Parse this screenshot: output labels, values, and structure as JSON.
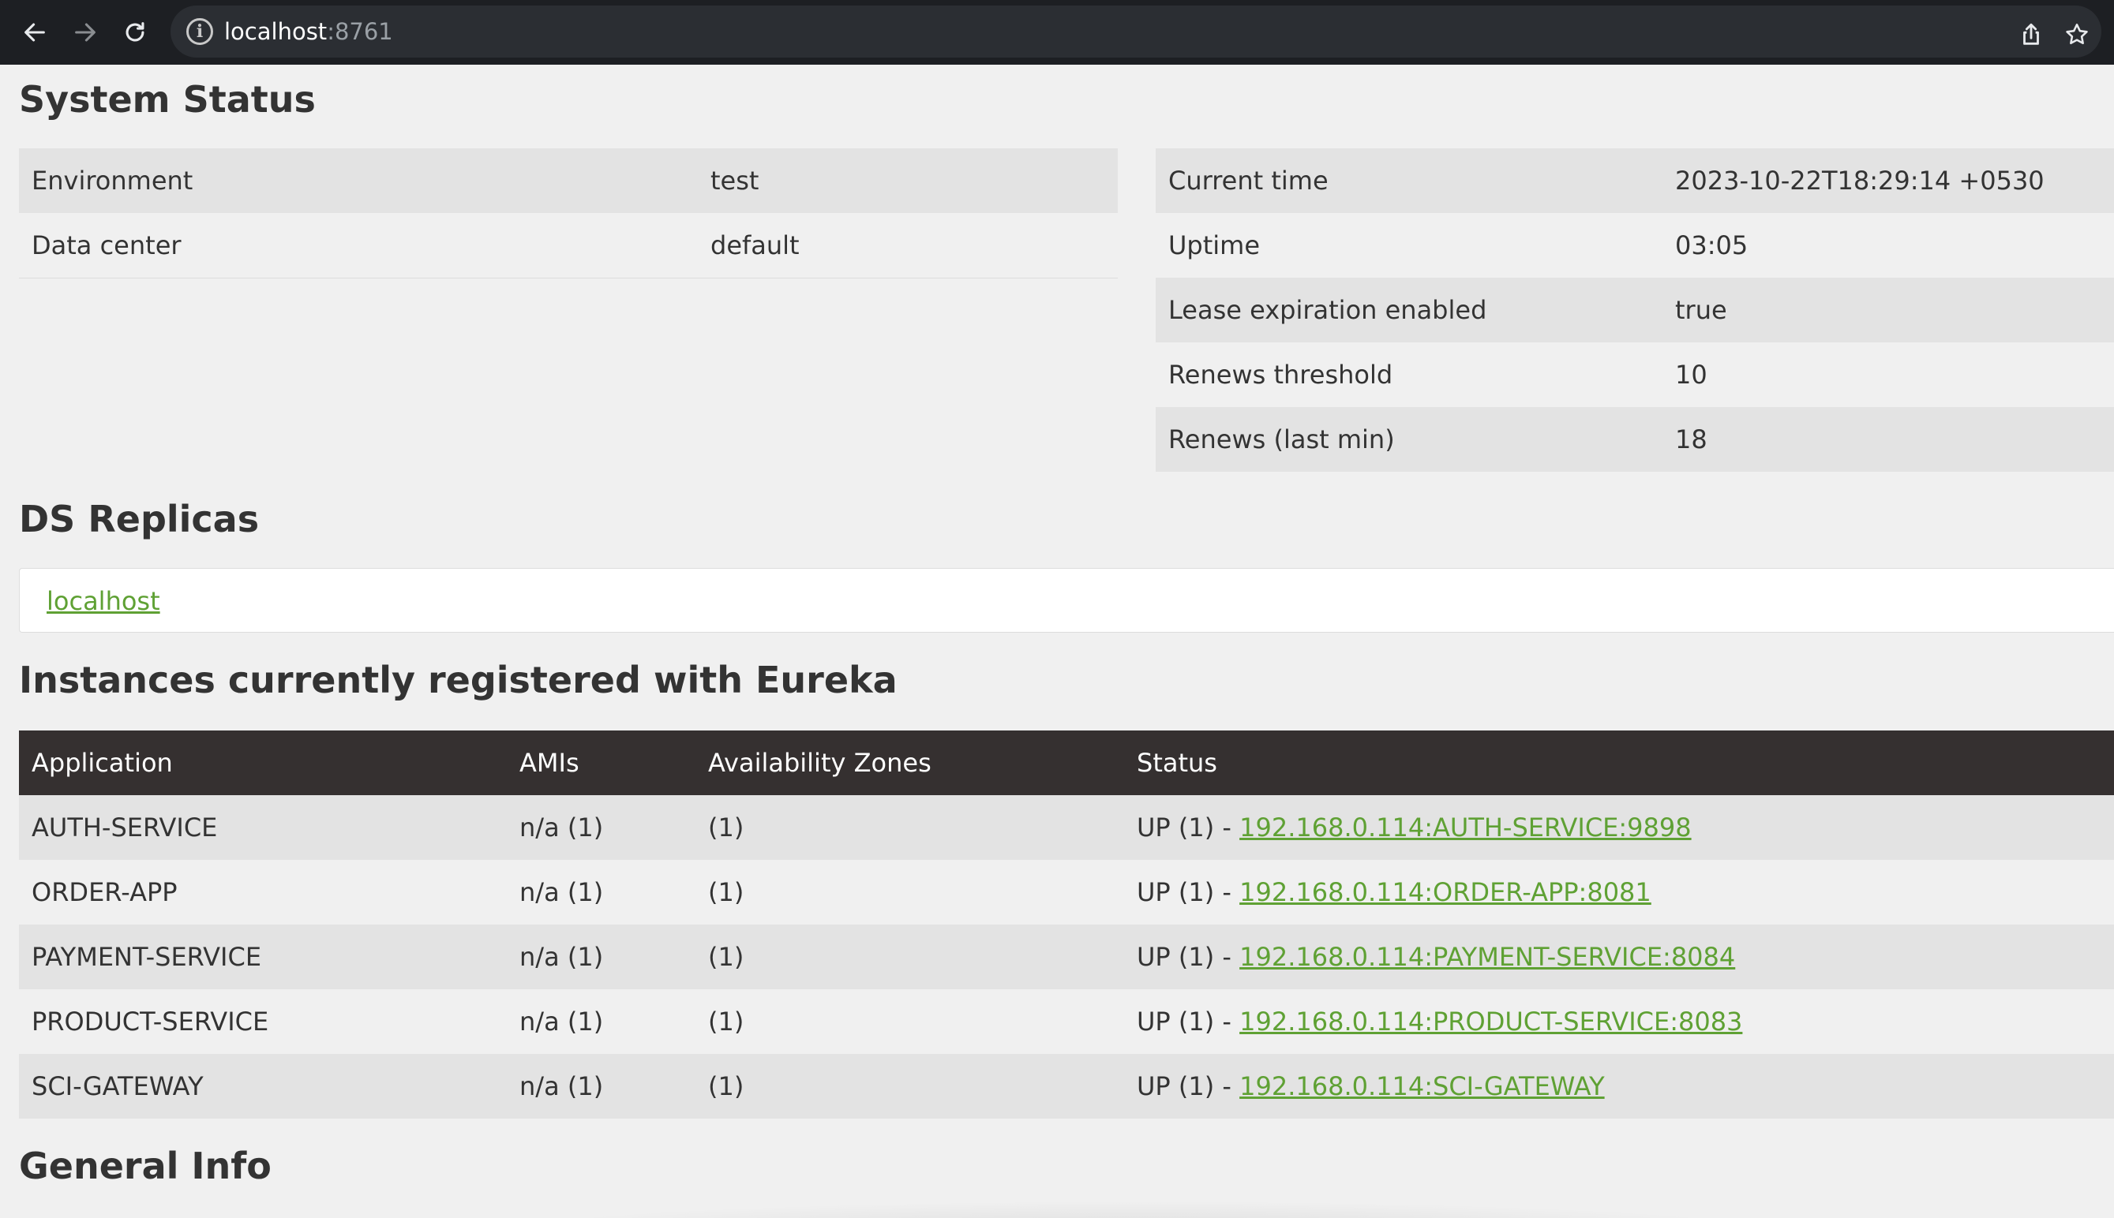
{
  "browser": {
    "url_host": "localhost",
    "url_port": ":8761"
  },
  "system_status": {
    "title": "System Status",
    "left": [
      {
        "label": "Environment",
        "value": "test"
      },
      {
        "label": "Data center",
        "value": "default"
      }
    ],
    "right": [
      {
        "label": "Current time",
        "value": "2023-10-22T18:29:14 +0530"
      },
      {
        "label": "Uptime",
        "value": "03:05"
      },
      {
        "label": "Lease expiration enabled",
        "value": "true"
      },
      {
        "label": "Renews threshold",
        "value": "10"
      },
      {
        "label": "Renews (last min)",
        "value": "18"
      }
    ]
  },
  "ds_replicas": {
    "title": "DS Replicas",
    "link": "localhost"
  },
  "instances": {
    "title": "Instances currently registered with Eureka",
    "headers": [
      "Application",
      "AMIs",
      "Availability Zones",
      "Status"
    ],
    "rows": [
      {
        "app": "AUTH-SERVICE",
        "amis": "n/a (1)",
        "zones": "(1)",
        "status": "UP (1) - ",
        "link": "192.168.0.114:AUTH-SERVICE:9898"
      },
      {
        "app": "ORDER-APP",
        "amis": "n/a (1)",
        "zones": "(1)",
        "status": "UP (1) - ",
        "link": "192.168.0.114:ORDER-APP:8081"
      },
      {
        "app": "PAYMENT-SERVICE",
        "amis": "n/a (1)",
        "zones": "(1)",
        "status": "UP (1) - ",
        "link": "192.168.0.114:PAYMENT-SERVICE:8084"
      },
      {
        "app": "PRODUCT-SERVICE",
        "amis": "n/a (1)",
        "zones": "(1)",
        "status": "UP (1) - ",
        "link": "192.168.0.114:PRODUCT-SERVICE:8083"
      },
      {
        "app": "SCI-GATEWAY",
        "amis": "n/a (1)",
        "zones": "(1)",
        "status": "UP (1) - ",
        "link": "192.168.0.114:SCI-GATEWAY"
      }
    ]
  },
  "general_info": {
    "title": "General Info"
  },
  "colors": {
    "link": "#5fa134",
    "header_bg": "#353030",
    "stripe": "#e3e3e3",
    "page_bg": "#f0f0f0",
    "chrome_bg": "#1d1f23"
  },
  "icons": [
    "back-arrow-icon",
    "forward-arrow-icon",
    "reload-icon",
    "info-icon",
    "share-icon",
    "star-icon"
  ]
}
